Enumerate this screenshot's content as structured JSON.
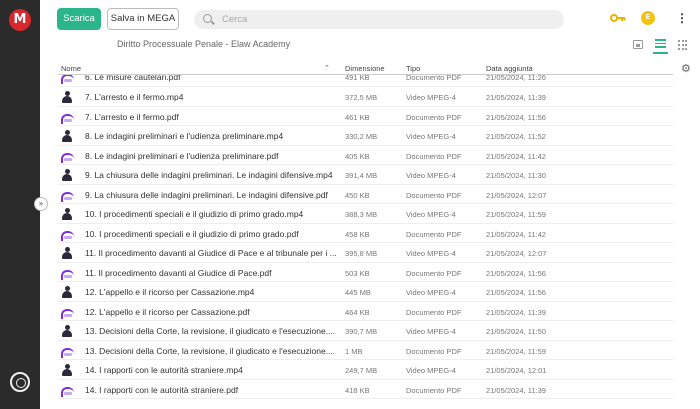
{
  "app": {
    "logo": "M"
  },
  "toolbar": {
    "download_label": "Scarica",
    "save_label": "Salva in MEGA"
  },
  "search": {
    "placeholder": "Cerca"
  },
  "user": {
    "initial": "E"
  },
  "breadcrumb": "Diritto Processuale Penale - Elaw Academy",
  "table": {
    "headers": {
      "name": "Nome",
      "size": "Dimensione",
      "type": "Tipo",
      "date": "Data aggiunta"
    },
    "rows": [
      {
        "name": "6. Le misure cautelari.pdf",
        "size": "491 KB",
        "type": "Documento PDF",
        "date": "21/05/2024, 11:26",
        "icon": "pdf"
      },
      {
        "name": "7. L'arresto e il fermo.mp4",
        "size": "372,5 MB",
        "type": "Video MPEG-4",
        "date": "21/05/2024, 11:39",
        "icon": "video"
      },
      {
        "name": "7. L'arresto e il fermo.pdf",
        "size": "461 KB",
        "type": "Documento PDF",
        "date": "21/05/2024, 11:56",
        "icon": "pdf"
      },
      {
        "name": "8. Le indagini preliminari e l'udienza preliminare.mp4",
        "size": "330,2 MB",
        "type": "Video MPEG-4",
        "date": "21/05/2024, 11:52",
        "icon": "video"
      },
      {
        "name": "8. Le indagini preliminari e l'udienza preliminare.pdf",
        "size": "405 KB",
        "type": "Documento PDF",
        "date": "21/05/2024, 11:42",
        "icon": "pdf"
      },
      {
        "name": "9. La chiusura delle indagini preliminari. Le indagini difensive.mp4",
        "size": "391,4 MB",
        "type": "Video MPEG-4",
        "date": "21/05/2024, 11:30",
        "icon": "video"
      },
      {
        "name": "9. La chiusura delle indagini preliminari. Le indagini difensive.pdf",
        "size": "450 KB",
        "type": "Documento PDF",
        "date": "21/05/2024, 12:07",
        "icon": "pdf"
      },
      {
        "name": "10. I procedimenti speciali e il giudizio di primo grado.mp4",
        "size": "388,3 MB",
        "type": "Video MPEG-4",
        "date": "21/05/2024, 11:59",
        "icon": "video"
      },
      {
        "name": "10. I procedimenti speciali e il giudizio di primo grado.pdf",
        "size": "458 KB",
        "type": "Documento PDF",
        "date": "21/05/2024, 11:42",
        "icon": "pdf"
      },
      {
        "name": "11. Il procedimento davanti al Giudice di Pace e al tribunale per i ...",
        "size": "395,8 MB",
        "type": "Video MPEG-4",
        "date": "21/05/2024, 12:07",
        "icon": "video"
      },
      {
        "name": "11. Il procedimento davanti al Giudice di Pace.pdf",
        "size": "503 KB",
        "type": "Documento PDF",
        "date": "21/05/2024, 11:56",
        "icon": "pdf"
      },
      {
        "name": "12. L'appello e il ricorso per Cassazione.mp4",
        "size": "445 MB",
        "type": "Video MPEG-4",
        "date": "21/05/2024, 11:56",
        "icon": "video"
      },
      {
        "name": "12. L'appello e il ricorso per Cassazione.pdf",
        "size": "464 KB",
        "type": "Documento PDF",
        "date": "21/05/2024, 11:39",
        "icon": "pdf"
      },
      {
        "name": "13. Decisioni della Corte, la revisione, il giudicato e l'esecuzione....",
        "size": "390,7 MB",
        "type": "Video MPEG-4",
        "date": "21/05/2024, 11:50",
        "icon": "video"
      },
      {
        "name": "13. Decisioni della Corte, la revisione, il giudicato e l'esecuzione....",
        "size": "1 MB",
        "type": "Documento PDF",
        "date": "21/05/2024, 11:59",
        "icon": "pdf"
      },
      {
        "name": "14. I rapporti con le autorità straniere.mp4",
        "size": "249,7 MB",
        "type": "Video MPEG-4",
        "date": "21/05/2024, 12:01",
        "icon": "video"
      },
      {
        "name": "14. I rapporti con le autorità straniere.pdf",
        "size": "418 KB",
        "type": "Documento PDF",
        "date": "21/05/2024, 11:39",
        "icon": "pdf"
      }
    ]
  },
  "colors": {
    "accent": "#2bb58a",
    "brand": "#d9272e",
    "pdf": "#7b2fdc",
    "rail": "#2b2b2b"
  }
}
